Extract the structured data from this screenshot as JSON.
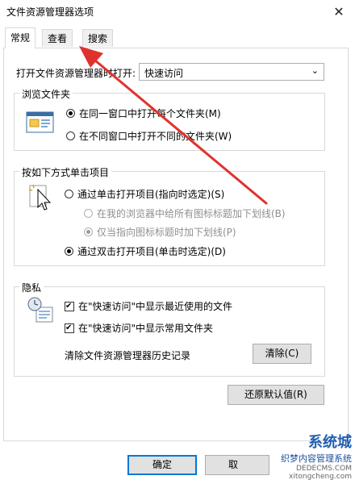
{
  "window": {
    "title": "文件资源管理器选项",
    "close_glyph": "✕"
  },
  "tabs": [
    "常规",
    "查看",
    "搜索"
  ],
  "general": {
    "open_label": "打开文件资源管理器时打开:",
    "open_value": "快速访问",
    "browse": {
      "title": "浏览文件夹",
      "same_window": "在同一窗口中打开每个文件夹(M)",
      "new_window": "在不同窗口中打开不同的文件夹(W)"
    },
    "click": {
      "title": "按如下方式单击项目",
      "single": "通过单击打开项目(指向时选定)(S)",
      "underline_all": "在我的浏览器中给所有图标标题加下划线(B)",
      "underline_point": "仅当指向图标标题时加下划线(P)",
      "double": "通过双击打开项目(单击时选定)(D)"
    },
    "privacy": {
      "title": "隐私",
      "recent_files": "在\"快速访问\"中显示最近使用的文件",
      "frequent_folders": "在\"快速访问\"中显示常用文件夹",
      "clear_label": "清除文件资源管理器历史记录",
      "clear_button": "清除(C)"
    },
    "restore_button": "还原默认值(R)"
  },
  "footer": {
    "ok": "确定",
    "cancel": "取"
  },
  "watermark": {
    "brand": "系统城",
    "sub": "织梦内容管理系统",
    "domain": "DEDECMS.COM",
    "url": "xitongcheng.com"
  },
  "colors": {
    "arrow": "#e0322d",
    "accent": "#0078d7"
  }
}
